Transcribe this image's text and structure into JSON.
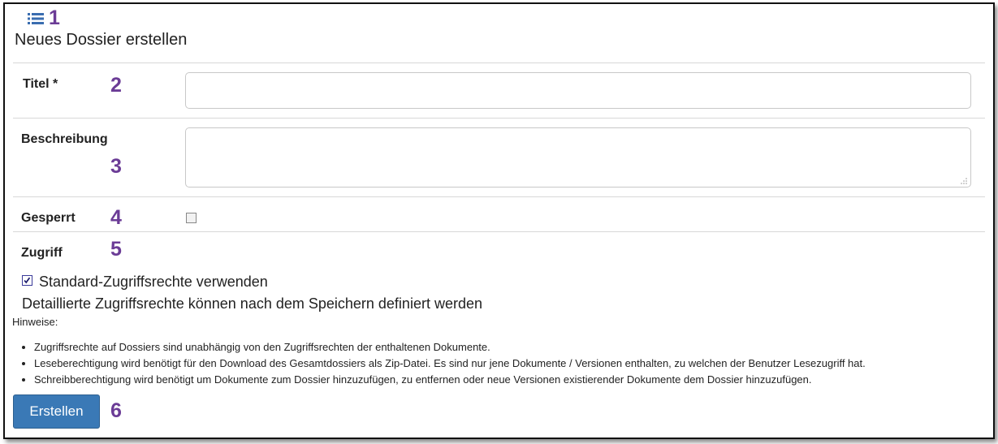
{
  "page_title": "Neues Dossier erstellen",
  "markers": [
    "1",
    "2",
    "3",
    "4",
    "5",
    "6"
  ],
  "form": {
    "title_label": "Titel *",
    "title_value": "",
    "description_label": "Beschreibung",
    "description_value": "",
    "locked_label": "Gesperrt",
    "locked_checked": false,
    "access_label": "Zugriff",
    "default_rights_label": "Standard-Zugriffsrechte verwenden",
    "default_rights_checked": true,
    "detail_note": "Detaillierte Zugriffsrechte können nach dem Speichern definiert werden",
    "hints_title": "Hinweise:",
    "hints": [
      "Zugriffsrechte auf Dossiers sind unabhängig von den Zugriffsrechten der enthaltenen Dokumente.",
      "Leseberechtigung wird benötigt für den Download des Gesamtdossiers als Zip-Datei. Es sind nur jene Dokumente / Versionen enthalten, zu welchen der Benutzer Lesezugriff hat.",
      "Schreibberechtigung wird benötigt um Dokumente zum Dossier hinzuzufügen, zu entfernen oder neue Versionen existierender Dokumente dem Dossier hinzuzufügen."
    ],
    "submit_label": "Erstellen"
  },
  "colors": {
    "marker": "#6b3c96",
    "button": "#3a79b6",
    "icon": "#3a6db0"
  },
  "icons": {
    "header": "list-icon"
  }
}
